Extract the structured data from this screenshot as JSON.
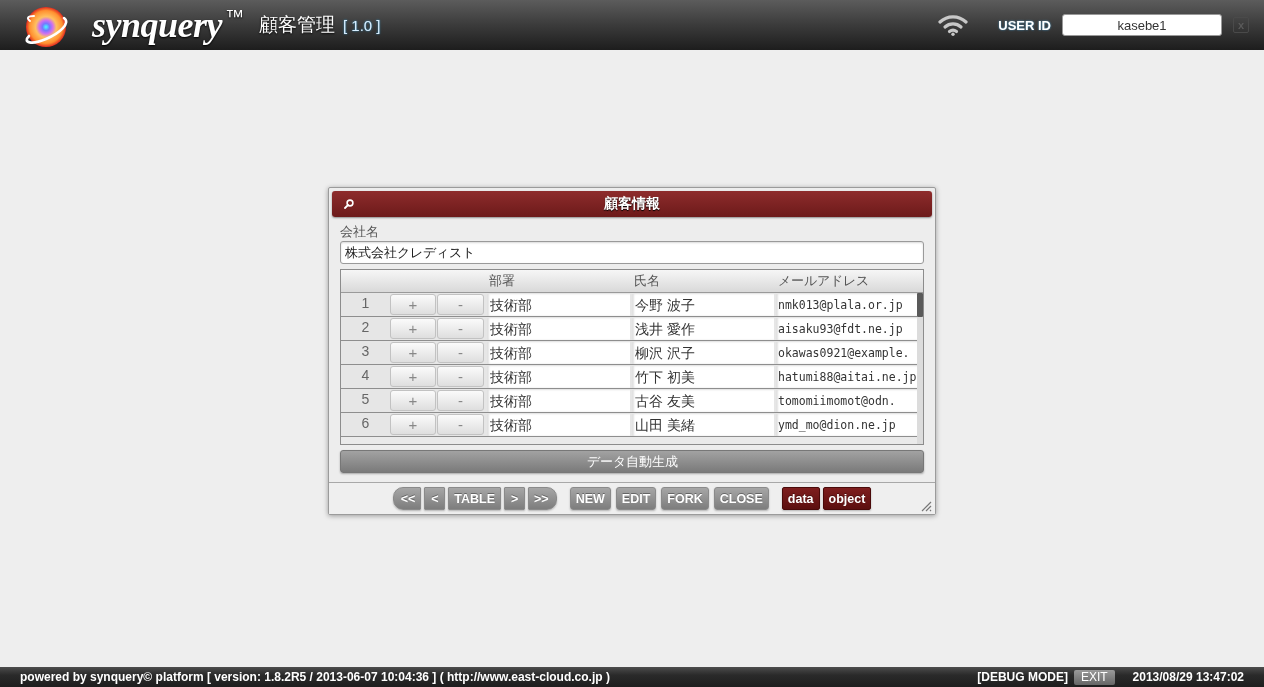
{
  "header": {
    "app_name": "synquery$^{™}$",
    "module": "顧客管理",
    "version": "[ 1.0 ]",
    "user_id_label": "USER ID",
    "user_id": "kasebe1",
    "close_label": "x"
  },
  "dialog": {
    "title": "顧客情報",
    "company_label": "会社名",
    "company_value": "株式会社クレディスト",
    "table": {
      "columns": [
        "部署",
        "氏名",
        "メールアドレス"
      ],
      "rows": [
        {
          "number": "1",
          "add": "+",
          "remove": "-",
          "department": "技術部",
          "name": "今野 波子",
          "email": "nmk013@plala.or.jp"
        },
        {
          "number": "2",
          "add": "+",
          "remove": "-",
          "department": "技術部",
          "name": "浅井 愛作",
          "email": "aisaku93@fdt.ne.jp"
        },
        {
          "number": "3",
          "add": "+",
          "remove": "-",
          "department": "技術部",
          "name": "柳沢 沢子",
          "email": "okawas0921@example."
        },
        {
          "number": "4",
          "add": "+",
          "remove": "-",
          "department": "技術部",
          "name": "竹下 初美",
          "email": "hatumi88@aitai.ne.jp"
        },
        {
          "number": "5",
          "add": "+",
          "remove": "-",
          "department": "技術部",
          "name": "古谷 友美",
          "email": "tomomiimomot@odn."
        },
        {
          "number": "6",
          "add": "+",
          "remove": "-",
          "department": "技術部",
          "name": "山田 美緒",
          "email": "ymd_mo@dion.ne.jp"
        }
      ]
    },
    "generate_button": "データ自動生成",
    "toolbar": [
      {
        "label": "<<",
        "kind": "nav"
      },
      {
        "label": "<",
        "kind": "nav"
      },
      {
        "label": "TABLE",
        "kind": "nav"
      },
      {
        "label": ">",
        "kind": "nav"
      },
      {
        "label": ">>",
        "kind": "nav"
      },
      {
        "label": "NEW",
        "kind": "action"
      },
      {
        "label": "EDIT",
        "kind": "action"
      },
      {
        "label": "FORK",
        "kind": "action"
      },
      {
        "label": "CLOSE",
        "kind": "action"
      },
      {
        "label": "data",
        "kind": "mode"
      },
      {
        "label": "object",
        "kind": "mode"
      }
    ]
  },
  "status_bar": {
    "powered_by": "powered by synquery© platform [ version: 1.8.2R5 / 2013-06-07 10:04:36 ] ( http://www.east-cloud.co.jp )",
    "debug_mode": "[DEBUG MODE]",
    "exit": "EXIT",
    "datetime": "2013/08/29 13:47:02"
  }
}
